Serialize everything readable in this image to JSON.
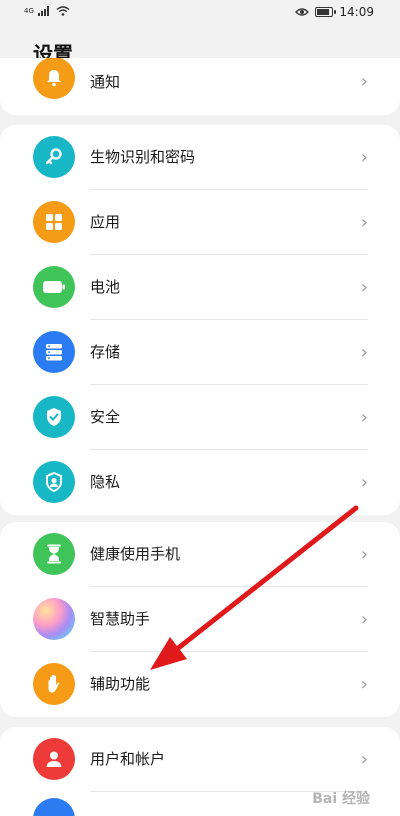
{
  "statusbar": {
    "network": "4G",
    "time": "14:09"
  },
  "header": {
    "title": "设置"
  },
  "colors": {
    "orange": "#f59b16",
    "teal": "#18b7c6",
    "green": "#3fc459",
    "blue": "#2b7cf2",
    "red": "#ef3a3a",
    "arrow": "#e0191b"
  },
  "groups": [
    {
      "items": [
        {
          "label": "通知",
          "icon": "bell-icon"
        }
      ]
    },
    {
      "items": [
        {
          "label": "生物识别和密码",
          "icon": "key-icon"
        },
        {
          "label": "应用",
          "icon": "apps-grid-icon"
        },
        {
          "label": "电池",
          "icon": "battery-icon"
        },
        {
          "label": "存储",
          "icon": "storage-icon"
        },
        {
          "label": "安全",
          "icon": "shield-check-icon"
        },
        {
          "label": "隐私",
          "icon": "privacy-icon"
        }
      ]
    },
    {
      "items": [
        {
          "label": "健康使用手机",
          "icon": "hourglass-icon"
        },
        {
          "label": "智慧助手",
          "icon": "assistant-icon"
        },
        {
          "label": "辅助功能",
          "icon": "hand-icon"
        }
      ]
    },
    {
      "items": [
        {
          "label": "用户和帐户",
          "icon": "user-icon"
        }
      ]
    }
  ],
  "watermark": "Bai 经验"
}
